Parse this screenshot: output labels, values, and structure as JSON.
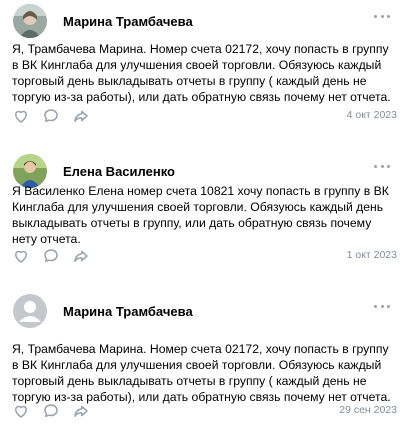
{
  "posts": [
    {
      "author": "Марина Трамбачева",
      "text": "Я, Трамбачева Марина. Номер счета 02172, хочу попасть в группу в ВК Кинглаба для улучшения своей торговли. Обязуюсь каждый торговый день выкладывать отчеты в группу ( каждый день не торгую из-за работы), или дать обратную связь почему нет отчета.",
      "date": "4 окт 2023",
      "avatar": "photo-avatar-icon"
    },
    {
      "author": "Елена Василенко",
      "text": "Я Василенко Елена номер счета 10821 хочу попасть в группу в ВК Кинглаба для улучшения своей торговли. Обязуюсь каждый день выкладывать отчеты в группу, или дать обратную связь почему нету отчета.",
      "date": "1 окт 2023",
      "avatar": "photo-avatar-icon"
    },
    {
      "author": "Марина Трамбачева",
      "text": "Я, Трамбачева Марина. Номер счета 02172, хочу попасть в группу в ВК Кинглаба для улучшения своей торговли. Обязуюсь каждый торговый день выкладывать отчеты в группу ( каждый день не торгую из-за работы), или дать обратную связь почему нет отчета.",
      "date": "29 сен 2023",
      "avatar": "default-user-avatar-icon"
    }
  ],
  "icons": {
    "like": "heart-icon",
    "comment": "comment-icon",
    "share": "share-icon",
    "more": "more-dots-icon"
  },
  "colors": {
    "secondary_text": "#818c99",
    "icon": "#99a2ad",
    "placeholder_avatar": "#c4c8cc"
  }
}
